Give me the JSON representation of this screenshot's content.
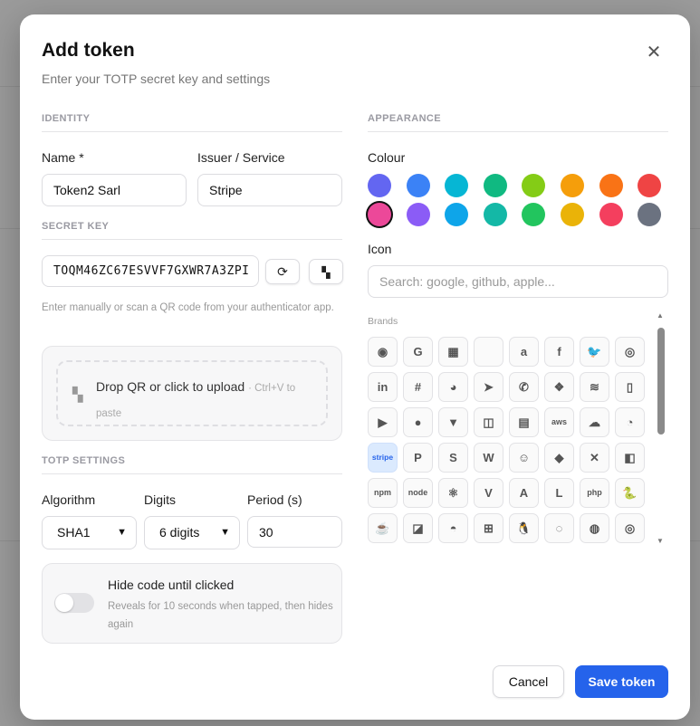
{
  "dialog": {
    "title": "Add token",
    "subtitle": "Enter your TOTP secret key and settings",
    "close_icon": "close-icon"
  },
  "identity": {
    "section": "IDENTITY",
    "name_label": "Name *",
    "name_value": "Token2 Sarl",
    "issuer_label": "Issuer / Service",
    "issuer_value": "Stripe"
  },
  "secret": {
    "section": "SECRET KEY",
    "value": "TOQM46ZC67ESVVF7GXWR7A3ZPI",
    "regenerate_icon": "refresh-icon",
    "scan_icon": "qr-code-icon",
    "help": "Enter manually or scan a QR code from your authenticator app.",
    "drop_text": "Drop QR or click to upload",
    "drop_hint": "· Ctrl+V to paste"
  },
  "totp": {
    "section": "TOTP SETTINGS",
    "algorithm_label": "Algorithm",
    "algorithm_value": "SHA1",
    "digits_label": "Digits",
    "digits_value": "6 digits",
    "period_label": "Period (s)",
    "period_value": "30",
    "hide_title": "Hide code until clicked",
    "hide_desc": "Reveals for 10 seconds when tapped, then hides again",
    "hide_enabled": false
  },
  "appearance": {
    "section": "APPEARANCE",
    "colour_label": "Colour",
    "colours": [
      "#6366f1",
      "#3b82f6",
      "#06b6d4",
      "#10b981",
      "#84cc16",
      "#f59e0b",
      "#f97316",
      "#ef4444",
      "#ec4899",
      "#8b5cf6",
      "#0ea5e9",
      "#14b8a6",
      "#22c55e",
      "#eab308",
      "#f43f5e",
      "#6b7280"
    ],
    "selected_colour": "#ec4899",
    "icon_label": "Icon",
    "icon_search_placeholder": "Search: google, github, apple...",
    "brands_label": "Brands",
    "selected_brand": "stripe",
    "brands": [
      {
        "name": "github",
        "glyph": "◉"
      },
      {
        "name": "google",
        "glyph": "G"
      },
      {
        "name": "microsoft",
        "glyph": "▦"
      },
      {
        "name": "apple",
        "glyph": ""
      },
      {
        "name": "amazon",
        "glyph": "a"
      },
      {
        "name": "facebook",
        "glyph": "f"
      },
      {
        "name": "twitter",
        "glyph": "🐦"
      },
      {
        "name": "instagram",
        "glyph": "◎"
      },
      {
        "name": "linkedin",
        "glyph": "in"
      },
      {
        "name": "slack",
        "glyph": "#"
      },
      {
        "name": "discord",
        "glyph": "◕"
      },
      {
        "name": "telegram",
        "glyph": "➤"
      },
      {
        "name": "whatsapp",
        "glyph": "✆"
      },
      {
        "name": "dropbox",
        "glyph": "❖"
      },
      {
        "name": "spotify",
        "glyph": "≋"
      },
      {
        "name": "twitch",
        "glyph": "▯"
      },
      {
        "name": "youtube",
        "glyph": "▶"
      },
      {
        "name": "reddit",
        "glyph": "●"
      },
      {
        "name": "gitlab",
        "glyph": "▼"
      },
      {
        "name": "bitbucket",
        "glyph": "◫"
      },
      {
        "name": "docker",
        "glyph": "▤"
      },
      {
        "name": "aws",
        "glyph": "aws"
      },
      {
        "name": "cloudflare",
        "glyph": "☁"
      },
      {
        "name": "digitalocean",
        "glyph": "◔"
      },
      {
        "name": "stripe",
        "glyph": "stripe"
      },
      {
        "name": "paypal",
        "glyph": "P"
      },
      {
        "name": "shopify",
        "glyph": "S"
      },
      {
        "name": "wordpress",
        "glyph": "W"
      },
      {
        "name": "jenkins",
        "glyph": "☺"
      },
      {
        "name": "jira",
        "glyph": "◆"
      },
      {
        "name": "confluence",
        "glyph": "✕"
      },
      {
        "name": "trello",
        "glyph": "◧"
      },
      {
        "name": "npm",
        "glyph": "npm"
      },
      {
        "name": "nodejs",
        "glyph": "node"
      },
      {
        "name": "react",
        "glyph": "⚛"
      },
      {
        "name": "vue",
        "glyph": "V"
      },
      {
        "name": "angular",
        "glyph": "A"
      },
      {
        "name": "laravel",
        "glyph": "L"
      },
      {
        "name": "php",
        "glyph": "php"
      },
      {
        "name": "python",
        "glyph": "🐍"
      },
      {
        "name": "java",
        "glyph": "☕"
      },
      {
        "name": "swift",
        "glyph": "◪"
      },
      {
        "name": "android",
        "glyph": "◓"
      },
      {
        "name": "windows",
        "glyph": "⊞"
      },
      {
        "name": "linux",
        "glyph": "🐧"
      },
      {
        "name": "ubuntu",
        "glyph": "◌"
      },
      {
        "name": "firefox",
        "glyph": "◍"
      },
      {
        "name": "chrome",
        "glyph": "◎"
      }
    ]
  },
  "footer": {
    "cancel": "Cancel",
    "save": "Save token"
  }
}
